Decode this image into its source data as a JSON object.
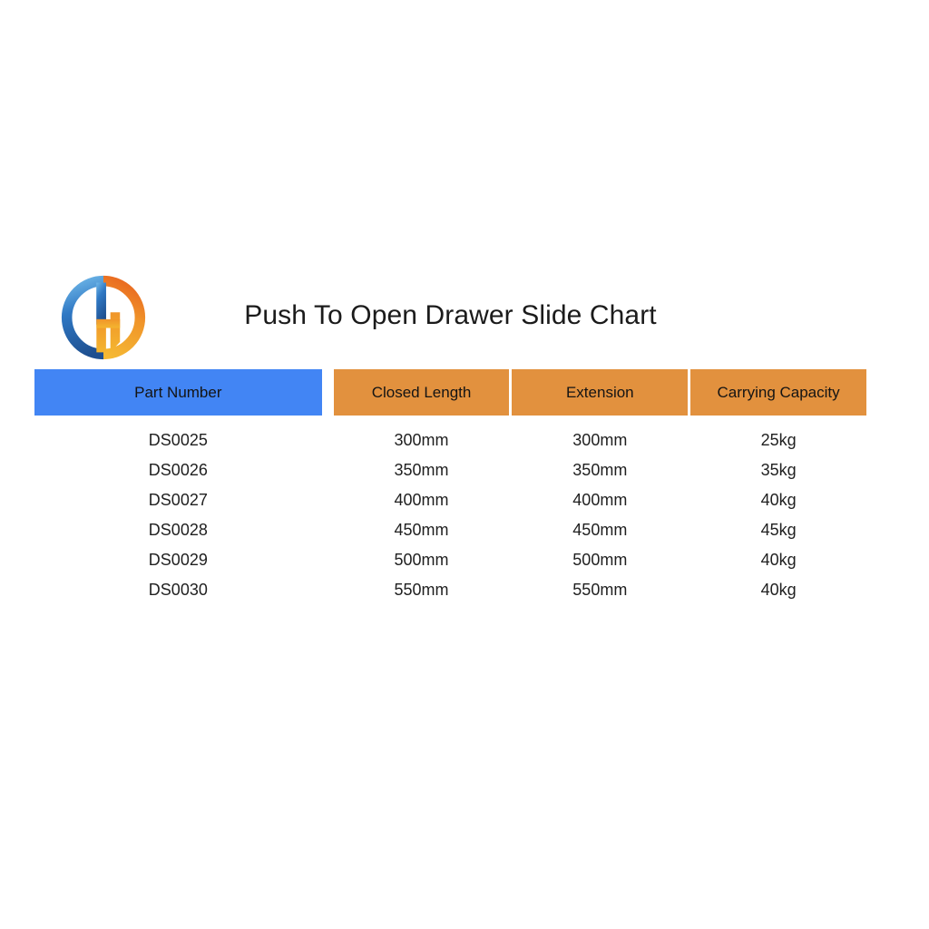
{
  "document": {
    "title": "Push To Open Drawer Slide Chart"
  },
  "logo": {
    "name": "company-logo",
    "blue_hex": "#2d6fc0",
    "orange_hex": "#ef8a21"
  },
  "colors": {
    "header_blue": "#4285f4",
    "header_orange": "#e2913e",
    "text": "#1f1f1f",
    "background": "#ffffff"
  },
  "table": {
    "columns": [
      "Part Number",
      "Closed Length",
      "Extension",
      "Carrying Capacity"
    ],
    "rows": [
      {
        "part_number": "DS0025",
        "closed_length": "300mm",
        "extension": "300mm",
        "carrying_capacity": "25kg"
      },
      {
        "part_number": "DS0026",
        "closed_length": "350mm",
        "extension": "350mm",
        "carrying_capacity": "35kg"
      },
      {
        "part_number": "DS0027",
        "closed_length": "400mm",
        "extension": "400mm",
        "carrying_capacity": "40kg"
      },
      {
        "part_number": "DS0028",
        "closed_length": "450mm",
        "extension": "450mm",
        "carrying_capacity": "45kg"
      },
      {
        "part_number": "DS0029",
        "closed_length": "500mm",
        "extension": "500mm",
        "carrying_capacity": "40kg"
      },
      {
        "part_number": "DS0030",
        "closed_length": "550mm",
        "extension": "550mm",
        "carrying_capacity": "40kg"
      }
    ]
  },
  "chart_data": {
    "type": "table",
    "title": "Push To Open Drawer Slide Chart",
    "categories": [
      "DS0025",
      "DS0026",
      "DS0027",
      "DS0028",
      "DS0029",
      "DS0030"
    ],
    "series": [
      {
        "name": "Closed Length",
        "unit": "mm",
        "values": [
          300,
          350,
          400,
          450,
          500,
          550
        ]
      },
      {
        "name": "Extension",
        "unit": "mm",
        "values": [
          300,
          350,
          400,
          450,
          500,
          550
        ]
      },
      {
        "name": "Carrying Capacity",
        "unit": "kg",
        "values": [
          25,
          35,
          40,
          45,
          40,
          40
        ]
      }
    ],
    "xlabel": "Part Number",
    "ylabel": "",
    "grid": false,
    "legend": "none"
  }
}
